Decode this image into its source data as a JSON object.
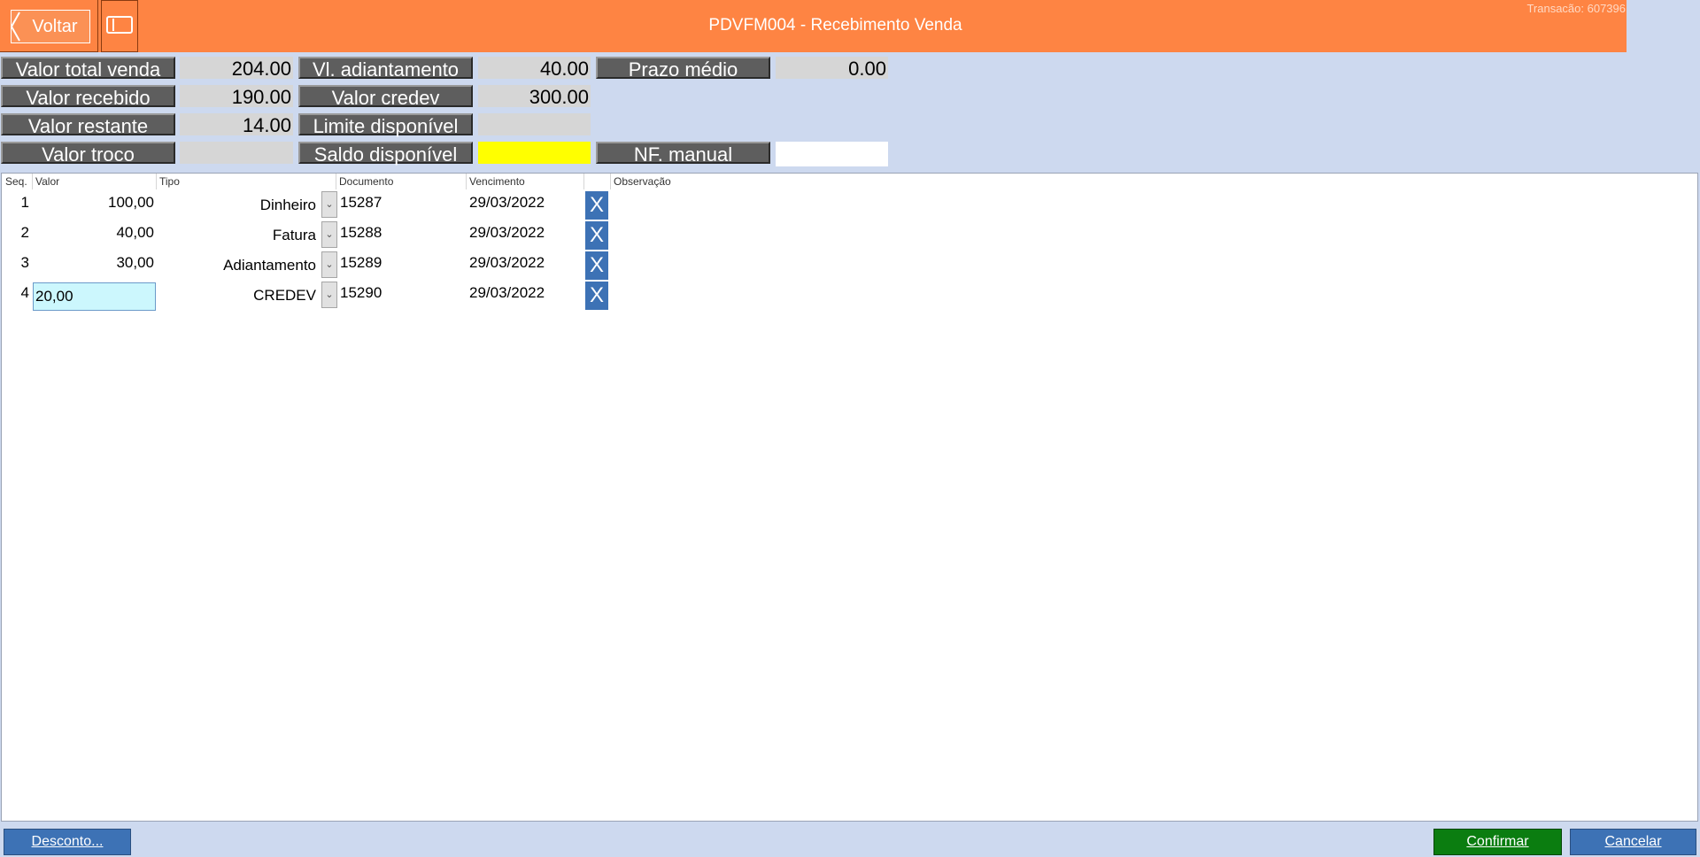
{
  "header": {
    "back_label": "Voltar",
    "title": "PDVFM004 - Recebimento Venda",
    "transaction": "Transacão: 607396"
  },
  "summary": {
    "total_venda": {
      "label": "Valor total venda",
      "value": "204.00"
    },
    "adiantamento": {
      "label": "Vl. adiantamento",
      "value": "40.00"
    },
    "prazo_medio": {
      "label": "Prazo médio",
      "value": "0.00"
    },
    "recebido": {
      "label": "Valor recebido",
      "value": "190.00"
    },
    "credev": {
      "label": "Valor credev",
      "value": "300.00"
    },
    "restante": {
      "label": "Valor restante",
      "value": "14.00"
    },
    "limite": {
      "label": "Limite disponível",
      "value": ""
    },
    "troco": {
      "label": "Valor troco",
      "value": ""
    },
    "saldo": {
      "label": "Saldo disponível",
      "value": ""
    },
    "nf_manual": {
      "label": "NF. manual",
      "value": ""
    }
  },
  "grid": {
    "columns": {
      "seq": "Seq.",
      "valor": "Valor",
      "tipo": "Tipo",
      "documento": "Documento",
      "vencimento": "Vencimento",
      "observacao": "Observação"
    },
    "rows": [
      {
        "seq": "1",
        "valor": "100,00",
        "tipo": "Dinheiro",
        "documento": "15287",
        "vencimento": "29/03/2022",
        "remove": "X"
      },
      {
        "seq": "2",
        "valor": "40,00",
        "tipo": "Fatura",
        "documento": "15288",
        "vencimento": "29/03/2022",
        "remove": "X"
      },
      {
        "seq": "3",
        "valor": "30,00",
        "tipo": "Adiantamento",
        "documento": "15289",
        "vencimento": "29/03/2022",
        "remove": "X"
      },
      {
        "seq": "4",
        "valor": "20,00",
        "tipo": "CREDEV",
        "documento": "15290",
        "vencimento": "29/03/2022",
        "remove": "X"
      }
    ]
  },
  "footer": {
    "desconto": "Desconto...",
    "confirmar": "Confirmar",
    "cancelar": "Cancelar"
  },
  "colors": {
    "header": "#fe8443",
    "background": "#cdd9ef",
    "label_bg": "#5e5e5e",
    "saldo_highlight": "#ffff00",
    "remove_button": "#3d72b5",
    "confirm_button": "#0b7d10",
    "footer_button": "#3d72b5"
  }
}
